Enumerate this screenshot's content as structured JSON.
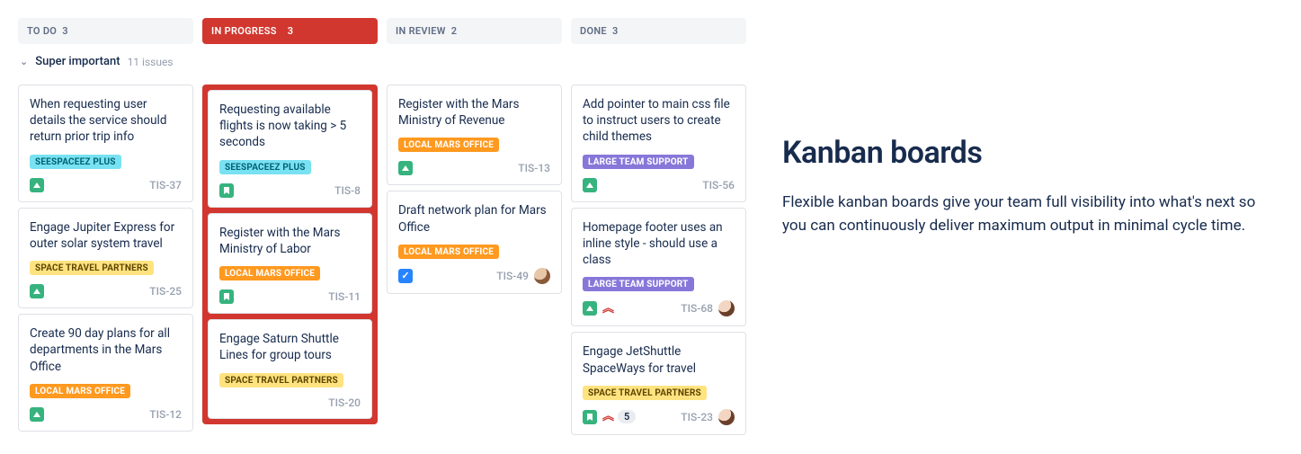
{
  "swimlane": {
    "title": "Super important",
    "count": "11 issues"
  },
  "columns": [
    {
      "label": "TO DO",
      "count": "3",
      "highlight": false
    },
    {
      "label": "IN PROGRESS",
      "count": "3",
      "highlight": true
    },
    {
      "label": "IN REVIEW",
      "count": "2",
      "highlight": false
    },
    {
      "label": "DONE",
      "count": "3",
      "highlight": false
    }
  ],
  "tags": {
    "seespaceez": {
      "text": "SEESPACEEZ PLUS",
      "bg": "#79E2F2",
      "fg": "#006273"
    },
    "space": {
      "text": "SPACE TRAVEL PARTNERS",
      "bg": "#FFE380",
      "fg": "#5E4500"
    },
    "local": {
      "text": "LOCAL MARS OFFICE",
      "bg": "#FF991F",
      "fg": "#FFFFFF"
    },
    "large": {
      "text": "LARGE TEAM SUPPORT",
      "bg": "#8777D9",
      "fg": "#FFFFFF"
    }
  },
  "cards": {
    "todo": [
      {
        "title": "When requesting user details the service should return prior trip info",
        "tag": "seespaceez",
        "key": "TIS-37",
        "left": [
          "arrow"
        ]
      },
      {
        "title": "Engage Jupiter Express for outer solar system travel",
        "tag": "space",
        "key": "TIS-25",
        "left": [
          "arrow"
        ]
      },
      {
        "title": "Create 90 day plans for all departments in the Mars Office",
        "tag": "local",
        "key": "TIS-12",
        "left": [
          "arrow"
        ]
      }
    ],
    "progress": [
      {
        "title": "Requesting available flights is now taking > 5 seconds",
        "tag": "seespaceez",
        "key": "TIS-8",
        "left": [
          "story"
        ]
      },
      {
        "title": "Register with the Mars Ministry of Labor",
        "tag": "local",
        "key": "TIS-11",
        "left": [
          "story"
        ]
      },
      {
        "title": "Engage Saturn Shuttle Lines for group tours",
        "tag": "space",
        "key": "TIS-20",
        "left": []
      }
    ],
    "review": [
      {
        "title": "Register with the Mars Ministry of Revenue",
        "tag": "local",
        "key": "TIS-13",
        "left": [
          "arrow"
        ]
      },
      {
        "title": "Draft network plan for Mars Office",
        "tag": "local",
        "key": "TIS-49",
        "left": [
          "check"
        ],
        "avatar": "a"
      }
    ],
    "done": [
      {
        "title": "Add pointer to main css file to instruct users to create child themes",
        "tag": "large",
        "key": "TIS-56",
        "left": [
          "arrow"
        ]
      },
      {
        "title": "Homepage footer uses an inline style - should use a class",
        "tag": "large",
        "key": "TIS-68",
        "left": [
          "arrow",
          "chevrons"
        ],
        "avatar": "b"
      },
      {
        "title": "Engage JetShuttle SpaceWays for travel",
        "tag": "space",
        "key": "TIS-23",
        "left": [
          "story",
          "chevrons",
          "count"
        ],
        "count": "5",
        "avatar": "b"
      }
    ]
  },
  "marketing": {
    "heading": "Kanban boards",
    "body": "Flexible kanban boards give your team full visibility into what's next so you can continuously deliver maximum output in minimal cycle time."
  }
}
